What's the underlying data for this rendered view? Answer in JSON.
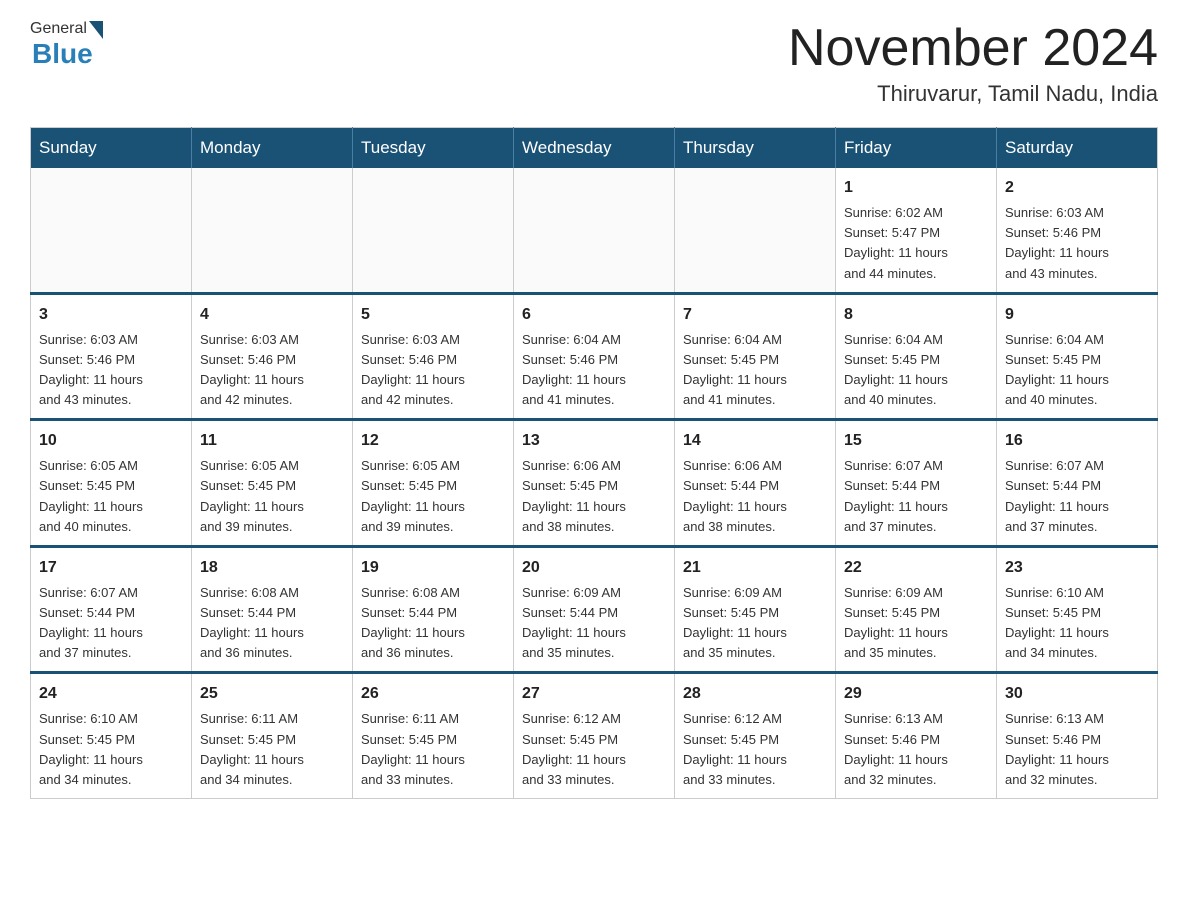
{
  "header": {
    "logo_general": "General",
    "logo_blue": "Blue",
    "month_title": "November 2024",
    "location": "Thiruvarur, Tamil Nadu, India"
  },
  "calendar": {
    "days_of_week": [
      "Sunday",
      "Monday",
      "Tuesday",
      "Wednesday",
      "Thursday",
      "Friday",
      "Saturday"
    ],
    "weeks": [
      [
        {
          "day": "",
          "info": ""
        },
        {
          "day": "",
          "info": ""
        },
        {
          "day": "",
          "info": ""
        },
        {
          "day": "",
          "info": ""
        },
        {
          "day": "",
          "info": ""
        },
        {
          "day": "1",
          "info": "Sunrise: 6:02 AM\nSunset: 5:47 PM\nDaylight: 11 hours\nand 44 minutes."
        },
        {
          "day": "2",
          "info": "Sunrise: 6:03 AM\nSunset: 5:46 PM\nDaylight: 11 hours\nand 43 minutes."
        }
      ],
      [
        {
          "day": "3",
          "info": "Sunrise: 6:03 AM\nSunset: 5:46 PM\nDaylight: 11 hours\nand 43 minutes."
        },
        {
          "day": "4",
          "info": "Sunrise: 6:03 AM\nSunset: 5:46 PM\nDaylight: 11 hours\nand 42 minutes."
        },
        {
          "day": "5",
          "info": "Sunrise: 6:03 AM\nSunset: 5:46 PM\nDaylight: 11 hours\nand 42 minutes."
        },
        {
          "day": "6",
          "info": "Sunrise: 6:04 AM\nSunset: 5:46 PM\nDaylight: 11 hours\nand 41 minutes."
        },
        {
          "day": "7",
          "info": "Sunrise: 6:04 AM\nSunset: 5:45 PM\nDaylight: 11 hours\nand 41 minutes."
        },
        {
          "day": "8",
          "info": "Sunrise: 6:04 AM\nSunset: 5:45 PM\nDaylight: 11 hours\nand 40 minutes."
        },
        {
          "day": "9",
          "info": "Sunrise: 6:04 AM\nSunset: 5:45 PM\nDaylight: 11 hours\nand 40 minutes."
        }
      ],
      [
        {
          "day": "10",
          "info": "Sunrise: 6:05 AM\nSunset: 5:45 PM\nDaylight: 11 hours\nand 40 minutes."
        },
        {
          "day": "11",
          "info": "Sunrise: 6:05 AM\nSunset: 5:45 PM\nDaylight: 11 hours\nand 39 minutes."
        },
        {
          "day": "12",
          "info": "Sunrise: 6:05 AM\nSunset: 5:45 PM\nDaylight: 11 hours\nand 39 minutes."
        },
        {
          "day": "13",
          "info": "Sunrise: 6:06 AM\nSunset: 5:45 PM\nDaylight: 11 hours\nand 38 minutes."
        },
        {
          "day": "14",
          "info": "Sunrise: 6:06 AM\nSunset: 5:44 PM\nDaylight: 11 hours\nand 38 minutes."
        },
        {
          "day": "15",
          "info": "Sunrise: 6:07 AM\nSunset: 5:44 PM\nDaylight: 11 hours\nand 37 minutes."
        },
        {
          "day": "16",
          "info": "Sunrise: 6:07 AM\nSunset: 5:44 PM\nDaylight: 11 hours\nand 37 minutes."
        }
      ],
      [
        {
          "day": "17",
          "info": "Sunrise: 6:07 AM\nSunset: 5:44 PM\nDaylight: 11 hours\nand 37 minutes."
        },
        {
          "day": "18",
          "info": "Sunrise: 6:08 AM\nSunset: 5:44 PM\nDaylight: 11 hours\nand 36 minutes."
        },
        {
          "day": "19",
          "info": "Sunrise: 6:08 AM\nSunset: 5:44 PM\nDaylight: 11 hours\nand 36 minutes."
        },
        {
          "day": "20",
          "info": "Sunrise: 6:09 AM\nSunset: 5:44 PM\nDaylight: 11 hours\nand 35 minutes."
        },
        {
          "day": "21",
          "info": "Sunrise: 6:09 AM\nSunset: 5:45 PM\nDaylight: 11 hours\nand 35 minutes."
        },
        {
          "day": "22",
          "info": "Sunrise: 6:09 AM\nSunset: 5:45 PM\nDaylight: 11 hours\nand 35 minutes."
        },
        {
          "day": "23",
          "info": "Sunrise: 6:10 AM\nSunset: 5:45 PM\nDaylight: 11 hours\nand 34 minutes."
        }
      ],
      [
        {
          "day": "24",
          "info": "Sunrise: 6:10 AM\nSunset: 5:45 PM\nDaylight: 11 hours\nand 34 minutes."
        },
        {
          "day": "25",
          "info": "Sunrise: 6:11 AM\nSunset: 5:45 PM\nDaylight: 11 hours\nand 34 minutes."
        },
        {
          "day": "26",
          "info": "Sunrise: 6:11 AM\nSunset: 5:45 PM\nDaylight: 11 hours\nand 33 minutes."
        },
        {
          "day": "27",
          "info": "Sunrise: 6:12 AM\nSunset: 5:45 PM\nDaylight: 11 hours\nand 33 minutes."
        },
        {
          "day": "28",
          "info": "Sunrise: 6:12 AM\nSunset: 5:45 PM\nDaylight: 11 hours\nand 33 minutes."
        },
        {
          "day": "29",
          "info": "Sunrise: 6:13 AM\nSunset: 5:46 PM\nDaylight: 11 hours\nand 32 minutes."
        },
        {
          "day": "30",
          "info": "Sunrise: 6:13 AM\nSunset: 5:46 PM\nDaylight: 11 hours\nand 32 minutes."
        }
      ]
    ]
  }
}
